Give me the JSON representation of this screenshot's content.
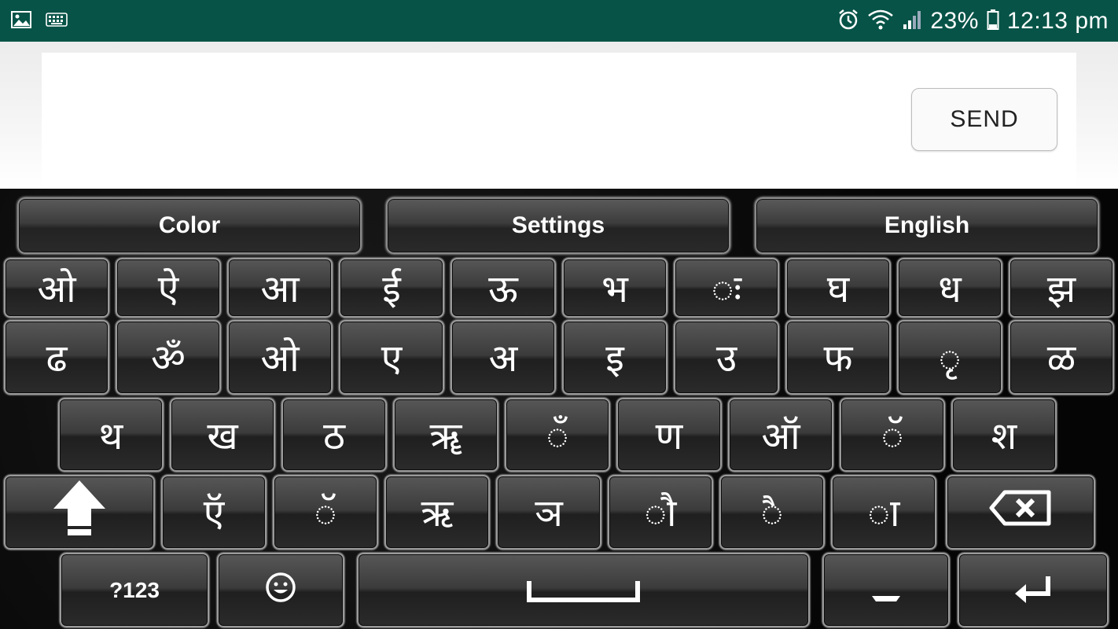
{
  "status_bar": {
    "battery": "23%",
    "time": "12:13 pm",
    "icons": [
      "gallery-icon",
      "keyboard-icon",
      "alarm-icon",
      "wifi-icon",
      "signal-icon",
      "battery-icon"
    ]
  },
  "compose": {
    "text": "",
    "send_label": "SEND"
  },
  "toolbar": {
    "color_label": "Color",
    "settings_label": "Settings",
    "language_label": "English"
  },
  "rows": {
    "row1": [
      "ओ",
      "ऐ",
      "आ",
      "ई",
      "ऊ",
      "भ",
      "ः",
      "घ",
      "ध",
      "झ"
    ],
    "row2": [
      "ढ",
      "ॐ",
      "ओ",
      "ए",
      "अ",
      "इ",
      "उ",
      "फ",
      "ृ",
      "ळ"
    ],
    "row3": [
      "थ",
      "ख",
      "ठ",
      "ॠ",
      "ँ",
      "ण",
      "ऑ",
      "ॅ",
      "श"
    ],
    "row4": [
      "ऍ",
      "ॅ",
      "ऋ",
      "ञ",
      "ौ",
      "ै",
      "ा"
    ]
  },
  "bottom_row": {
    "numbers_label": "?123"
  },
  "colors": {
    "status_bar": "#075347",
    "keyboard_bg": "#000000",
    "key_text": "#ffffff"
  }
}
